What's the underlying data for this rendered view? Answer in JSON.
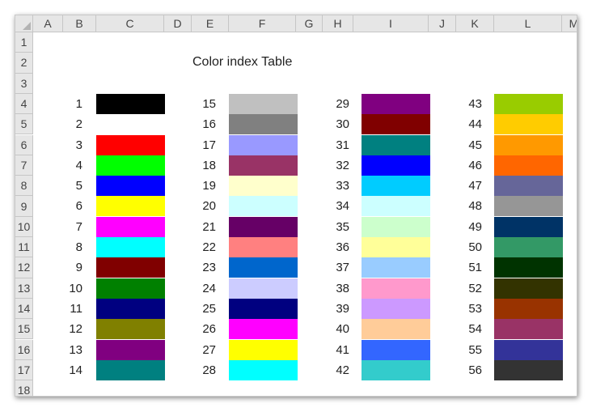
{
  "sheet": {
    "columns": [
      "A",
      "B",
      "C",
      "D",
      "E",
      "F",
      "G",
      "H",
      "I",
      "J",
      "K",
      "L",
      "M"
    ],
    "rows": [
      "1",
      "2",
      "3",
      "4",
      "5",
      "6",
      "7",
      "8",
      "9",
      "10",
      "11",
      "12",
      "13",
      "14",
      "15",
      "16",
      "17",
      "18"
    ],
    "title": "Color index Table"
  },
  "palette": [
    {
      "index": "1",
      "color": "#000000"
    },
    {
      "index": "2",
      "color": "#FFFFFF"
    },
    {
      "index": "3",
      "color": "#FF0000"
    },
    {
      "index": "4",
      "color": "#00FF00"
    },
    {
      "index": "5",
      "color": "#0000FF"
    },
    {
      "index": "6",
      "color": "#FFFF00"
    },
    {
      "index": "7",
      "color": "#FF00FF"
    },
    {
      "index": "8",
      "color": "#00FFFF"
    },
    {
      "index": "9",
      "color": "#800000"
    },
    {
      "index": "10",
      "color": "#008000"
    },
    {
      "index": "11",
      "color": "#000080"
    },
    {
      "index": "12",
      "color": "#808000"
    },
    {
      "index": "13",
      "color": "#800080"
    },
    {
      "index": "14",
      "color": "#008080"
    },
    {
      "index": "15",
      "color": "#C0C0C0"
    },
    {
      "index": "16",
      "color": "#808080"
    },
    {
      "index": "17",
      "color": "#9999FF"
    },
    {
      "index": "18",
      "color": "#993366"
    },
    {
      "index": "19",
      "color": "#FFFFCC"
    },
    {
      "index": "20",
      "color": "#CCFFFF"
    },
    {
      "index": "21",
      "color": "#660066"
    },
    {
      "index": "22",
      "color": "#FF8080"
    },
    {
      "index": "23",
      "color": "#0066CC"
    },
    {
      "index": "24",
      "color": "#CCCCFF"
    },
    {
      "index": "25",
      "color": "#000080"
    },
    {
      "index": "26",
      "color": "#FF00FF"
    },
    {
      "index": "27",
      "color": "#FFFF00"
    },
    {
      "index": "28",
      "color": "#00FFFF"
    },
    {
      "index": "29",
      "color": "#800080"
    },
    {
      "index": "30",
      "color": "#800000"
    },
    {
      "index": "31",
      "color": "#008080"
    },
    {
      "index": "32",
      "color": "#0000FF"
    },
    {
      "index": "33",
      "color": "#00CCFF"
    },
    {
      "index": "34",
      "color": "#CCFFFF"
    },
    {
      "index": "35",
      "color": "#CCFFCC"
    },
    {
      "index": "36",
      "color": "#FFFF99"
    },
    {
      "index": "37",
      "color": "#99CCFF"
    },
    {
      "index": "38",
      "color": "#FF99CC"
    },
    {
      "index": "39",
      "color": "#CC99FF"
    },
    {
      "index": "40",
      "color": "#FFCC99"
    },
    {
      "index": "41",
      "color": "#3366FF"
    },
    {
      "index": "42",
      "color": "#33CCCC"
    },
    {
      "index": "43",
      "color": "#99CC00"
    },
    {
      "index": "44",
      "color": "#FFCC00"
    },
    {
      "index": "45",
      "color": "#FF9900"
    },
    {
      "index": "46",
      "color": "#FF6600"
    },
    {
      "index": "47",
      "color": "#666699"
    },
    {
      "index": "48",
      "color": "#969696"
    },
    {
      "index": "49",
      "color": "#003366"
    },
    {
      "index": "50",
      "color": "#339966"
    },
    {
      "index": "51",
      "color": "#003300"
    },
    {
      "index": "52",
      "color": "#333300"
    },
    {
      "index": "53",
      "color": "#993300"
    },
    {
      "index": "54",
      "color": "#993366"
    },
    {
      "index": "55",
      "color": "#333399"
    },
    {
      "index": "56",
      "color": "#333333"
    }
  ]
}
